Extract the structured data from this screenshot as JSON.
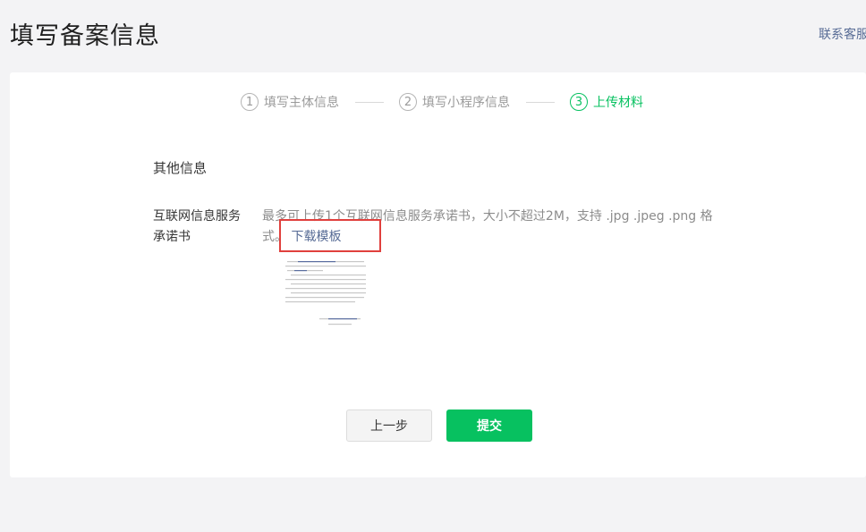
{
  "header": {
    "title": "填写备案信息",
    "contact_label": "联系客服"
  },
  "steps": [
    {
      "num": "1",
      "label": "填写主体信息",
      "active": false
    },
    {
      "num": "2",
      "label": "填写小程序信息",
      "active": false
    },
    {
      "num": "3",
      "label": "上传材料",
      "active": true
    }
  ],
  "form": {
    "section_title": "其他信息",
    "field_label": "互联网信息服务承诺书",
    "field_desc": "最多可上传1个互联网信息服务承诺书，大小不超过2M，支持 .jpg .jpeg .png 格式。",
    "download_label": "下载模板"
  },
  "buttons": {
    "prev_label": "上一步",
    "submit_label": "提交"
  },
  "colors": {
    "accent": "#07c160",
    "link": "#576b95",
    "highlight": "#e0403d"
  }
}
